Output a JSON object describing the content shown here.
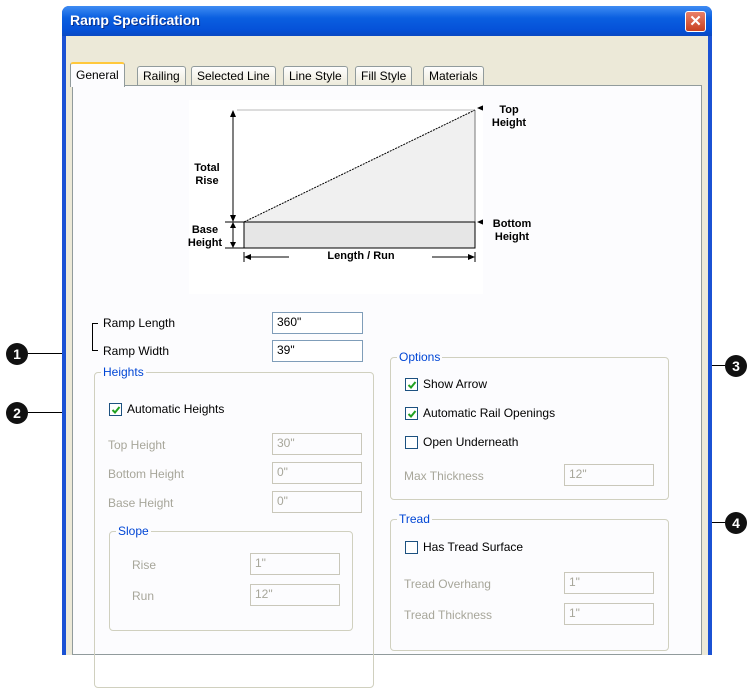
{
  "window": {
    "title": "Ramp Specification",
    "close_glyph": "✕"
  },
  "tabs": [
    {
      "label": "General"
    },
    {
      "label": "Railing"
    },
    {
      "label": "Selected Line"
    },
    {
      "label": "Line Style"
    },
    {
      "label": "Fill Style"
    },
    {
      "label": "Materials"
    }
  ],
  "diagram": {
    "top_height": "Top\nHeight",
    "total_rise": "Total\nRise",
    "base_height": "Base\nHeight",
    "bottom_height": "Bottom\nHeight",
    "length_run": "Length / Run"
  },
  "ramp": {
    "length_label": "Ramp Length",
    "length_value": "360\"",
    "width_label": "Ramp Width",
    "width_value": "39\""
  },
  "heights": {
    "title": "Heights",
    "automatic_label": "Automatic Heights",
    "automatic_checked": true,
    "top_label": "Top Height",
    "top_value": "30\"",
    "bottom_label": "Bottom Height",
    "bottom_value": "0\"",
    "base_label": "Base Height",
    "base_value": "0\"",
    "slope": {
      "title": "Slope",
      "rise_label": "Rise",
      "rise_value": "1\"",
      "run_label": "Run",
      "run_value": "12\""
    }
  },
  "options": {
    "title": "Options",
    "show_arrow_label": "Show Arrow",
    "show_arrow_checked": true,
    "auto_rail_label": "Automatic Rail Openings",
    "auto_rail_checked": true,
    "open_under_label": "Open Underneath",
    "open_under_checked": false,
    "max_thickness_label": "Max Thickness",
    "max_thickness_value": "12\""
  },
  "tread": {
    "title": "Tread",
    "has_surface_label": "Has Tread Surface",
    "has_surface_checked": false,
    "overhang_label": "Tread Overhang",
    "overhang_value": "1\"",
    "thickness_label": "Tread Thickness",
    "thickness_value": "1\""
  },
  "callouts": [
    "1",
    "2",
    "3",
    "4"
  ],
  "colors": {
    "title_bar": "#0a5fe0",
    "group_title": "#0046d5",
    "tab_highlight": "#ffc83c"
  }
}
